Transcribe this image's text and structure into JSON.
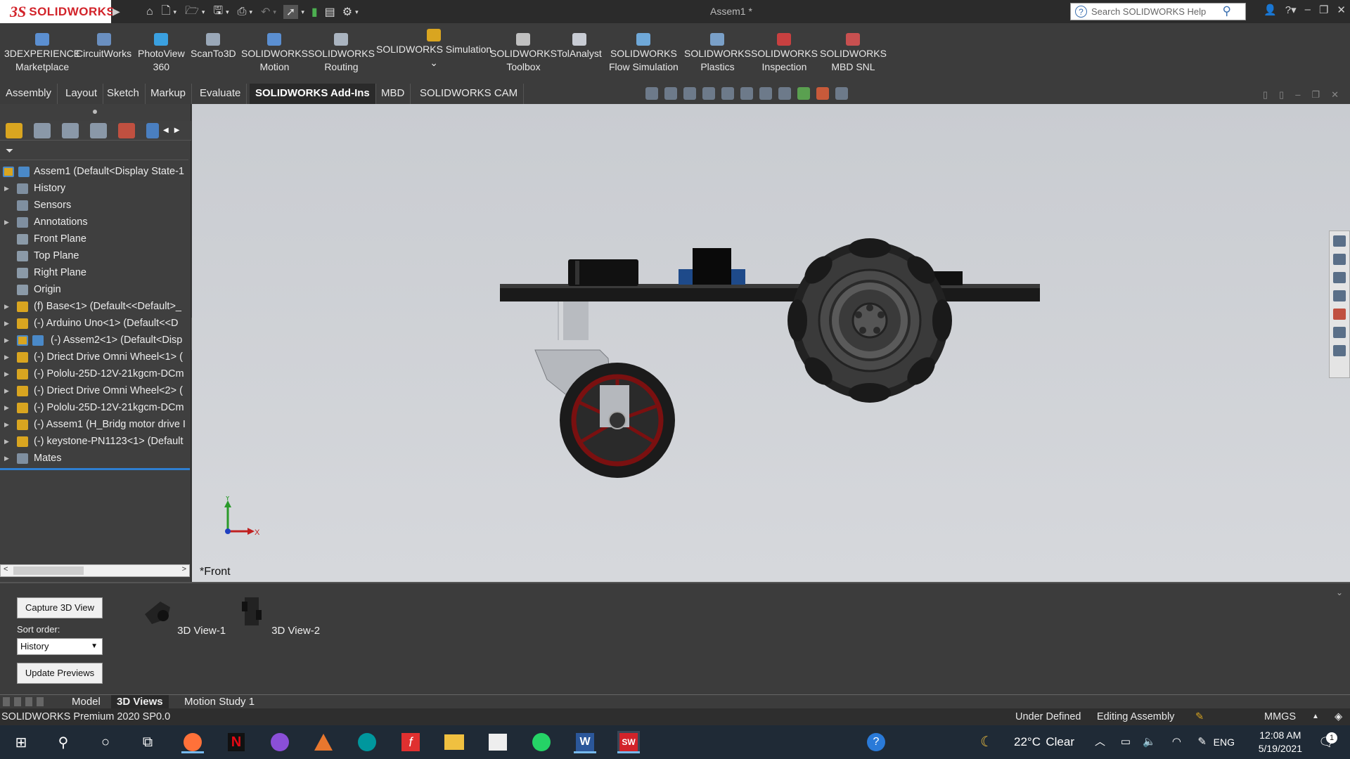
{
  "titlebar": {
    "app_logo_ds": "3S",
    "app_logo_text": "SOLIDWORKS",
    "document_title": "Assem1 *",
    "search_placeholder": "Search SOLIDWORKS Help"
  },
  "ribbon": {
    "buttons": [
      {
        "line1": "3DEXPERIENCE",
        "line2": "Marketplace",
        "icon": "globe-icon",
        "color": "#5b8fd1"
      },
      {
        "line1": "CircuitWorks",
        "line2": "",
        "icon": "circuitworks-icon",
        "color": "#6a8fc0"
      },
      {
        "line1": "PhotoView",
        "line2": "360",
        "icon": "photoview-icon",
        "color": "#3aa0e0"
      },
      {
        "line1": "ScanTo3D",
        "line2": "",
        "icon": "scanto3d-icon",
        "color": "#9aa8b8"
      },
      {
        "line1": "SOLIDWORKS",
        "line2": "Motion",
        "icon": "motion-icon",
        "color": "#5b8fd1"
      },
      {
        "line1": "SOLIDWORKS",
        "line2": "Routing",
        "icon": "routing-icon",
        "color": "#aab4c0"
      },
      {
        "line1": "SOLIDWORKS Simulation",
        "line2": "",
        "icon": "simulation-icon",
        "color": "#d9a520"
      },
      {
        "line1": "SOLIDWORKS",
        "line2": "Toolbox",
        "icon": "toolbox-icon",
        "color": "#c0c0c0"
      },
      {
        "line1": "TolAnalyst",
        "line2": "",
        "icon": "tolanalyst-icon",
        "color": "#c8ccd4"
      },
      {
        "line1": "SOLIDWORKS",
        "line2": "Flow Simulation",
        "icon": "flow-simulation-icon",
        "color": "#6fa8d8"
      },
      {
        "line1": "SOLIDWORKS",
        "line2": "Plastics",
        "icon": "plastics-icon",
        "color": "#7aa0c8"
      },
      {
        "line1": "SOLIDWORKS",
        "line2": "Inspection",
        "icon": "inspection-icon",
        "color": "#c84040"
      },
      {
        "line1": "SOLIDWORKS",
        "line2": "MBD SNL",
        "icon": "mbd-snl-icon",
        "color": "#c85050"
      }
    ]
  },
  "tabs": [
    "Assembly",
    "Layout",
    "Sketch",
    "Markup",
    "Evaluate",
    "SOLIDWORKS Add-Ins",
    "MBD",
    "SOLIDWORKS CAM"
  ],
  "active_tab": "SOLIDWORKS Add-Ins",
  "tree": {
    "root": "Assem1  (Default<Display State-1",
    "items": [
      {
        "label": "History",
        "expand": true,
        "icon": "history-icon"
      },
      {
        "label": "Sensors",
        "expand": false,
        "icon": "sensor-icon"
      },
      {
        "label": "Annotations",
        "expand": true,
        "icon": "annotations-icon"
      },
      {
        "label": "Front Plane",
        "expand": false,
        "icon": "plane-icon"
      },
      {
        "label": "Top Plane",
        "expand": false,
        "icon": "plane-icon"
      },
      {
        "label": "Right Plane",
        "expand": false,
        "icon": "plane-icon"
      },
      {
        "label": "Origin",
        "expand": false,
        "icon": "origin-icon"
      },
      {
        "label": "(f) Base<1> (Default<<Default>_",
        "expand": true,
        "icon": "part-icon"
      },
      {
        "label": "(-) Arduino Uno<1> (Default<<D",
        "expand": true,
        "icon": "part-icon"
      },
      {
        "label": "(-) Assem2<1> (Default<Disp",
        "expand": true,
        "icon": "subassembly-icon"
      },
      {
        "label": "(-) Driect Drive Omni Wheel<1> (",
        "expand": true,
        "icon": "part-icon"
      },
      {
        "label": "(-) Pololu-25D-12V-21kgcm-DCm",
        "expand": true,
        "icon": "part-icon"
      },
      {
        "label": "(-) Driect Drive Omni Wheel<2> (",
        "expand": true,
        "icon": "part-icon"
      },
      {
        "label": "(-) Pololu-25D-12V-21kgcm-DCm",
        "expand": true,
        "icon": "part-icon"
      },
      {
        "label": "(-) Assem1 (H_Bridg motor drive I",
        "expand": true,
        "icon": "part-icon"
      },
      {
        "label": "(-) keystone-PN1123<1> (Default",
        "expand": true,
        "icon": "part-icon"
      },
      {
        "label": "Mates",
        "expand": true,
        "icon": "mates-icon"
      }
    ]
  },
  "viewport": {
    "view_name": "*Front",
    "triad_x": "X",
    "triad_y": "Y"
  },
  "bottom_panel": {
    "capture_button": "Capture 3D View",
    "sort_label": "Sort order:",
    "sort_value": "History",
    "update_button": "Update Previews",
    "views": [
      "3D View-1",
      "3D View-2"
    ]
  },
  "bottom_tabs": [
    "Model",
    "3D Views",
    "Motion Study 1"
  ],
  "active_bottom_tab": "3D Views",
  "status": {
    "product": "SOLIDWORKS Premium 2020 SP0.0",
    "state": "Under Defined",
    "mode": "Editing Assembly",
    "units": "MMGS"
  },
  "taskbar": {
    "weather_temp": "22°C",
    "weather_desc": "Clear",
    "language": "ENG",
    "time": "12:08 AM",
    "date": "5/19/2021",
    "notification_count": "1"
  }
}
